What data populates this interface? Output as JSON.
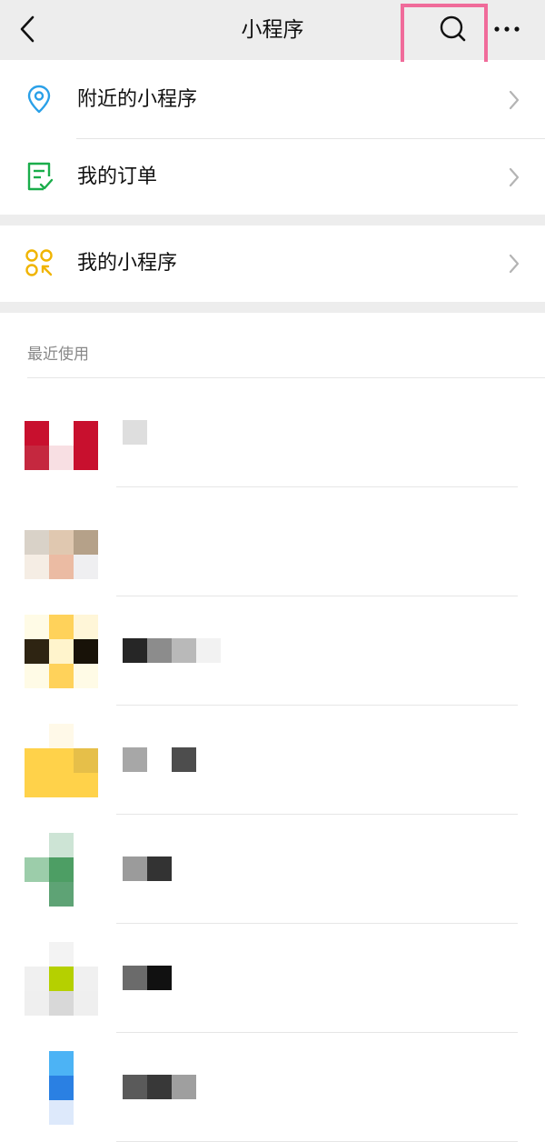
{
  "header": {
    "title": "小程序",
    "back_icon": "chevron-left-icon",
    "search_icon": "search-icon",
    "more_icon": "more-horizontal-icon",
    "highlight_color": "#f06b9a"
  },
  "menu": [
    {
      "label": "附近的小程序",
      "icon": "location-pin-icon",
      "color": "#2aa0e8"
    },
    {
      "label": "我的订单",
      "icon": "order-list-icon",
      "color": "#1aad4b"
    },
    {
      "label": "我的小程序",
      "icon": "mini-programs-icon",
      "color": "#f0b400"
    }
  ],
  "recent": {
    "title": "最近使用",
    "items": [
      {
        "icon_name": "app-icon-red",
        "name": "",
        "tiles": [
          "#ffffff",
          "#ffffff",
          "#ffffff",
          "#c8102e",
          "#ffffff",
          "#c8102e",
          "#c5283f",
          "#f8dfe3",
          "#c8102e"
        ],
        "name_tiles": [
          "#dedede"
        ]
      },
      {
        "icon_name": "app-icon-beige",
        "name": "",
        "tiles": [
          "#ffffff",
          "#ffffff",
          "#ffffff",
          "#d9d2c8",
          "#e0c8b0",
          "#b5a189",
          "#f5ede4",
          "#ebbba3",
          "#efeff1"
        ],
        "name_tiles": []
      },
      {
        "icon_name": "app-icon-yellow-black",
        "name": "",
        "tiles": [
          "#fffbe6",
          "#ffd25a",
          "#fff6d8",
          "#2e2412",
          "#fff4cc",
          "#181208",
          "#fffbe6",
          "#ffd25a",
          "#fffbe6"
        ],
        "name_tiles": [
          "#262626",
          "#8c8c8c",
          "#b9b9b9",
          "#f2f2f2"
        ]
      },
      {
        "icon_name": "app-icon-yellow-folder",
        "name": "",
        "tiles": [
          "#ffffff",
          "#fff9e8",
          "#ffffff",
          "#ffd24a",
          "#ffd24a",
          "#e6bf49",
          "#ffd24a",
          "#ffd24a",
          "#ffd24a"
        ],
        "name_tiles": [
          "#a7a7a7",
          "#ffffff",
          "#4d4d4d"
        ]
      },
      {
        "icon_name": "app-icon-green-cross",
        "name": "",
        "tiles": [
          "#ffffff",
          "#cde4d5",
          "#ffffff",
          "#9ccdaa",
          "#4d9e64",
          "#ffffff",
          "#ffffff",
          "#5ea375",
          "#ffffff"
        ],
        "name_tiles": [
          "#9b9b9b",
          "#333333"
        ]
      },
      {
        "icon_name": "app-icon-lime",
        "name": "",
        "tiles": [
          "#ffffff",
          "#f3f3f3",
          "#ffffff",
          "#f0f0f0",
          "#b5d000",
          "#f0f0f0",
          "#efefef",
          "#d8d8d8",
          "#efefef"
        ],
        "name_tiles": [
          "#6b6b6b",
          "#111111"
        ]
      },
      {
        "icon_name": "app-icon-blue",
        "name": "",
        "tiles": [
          "#ffffff",
          "#4cb3f5",
          "#ffffff",
          "#ffffff",
          "#2a80e3",
          "#ffffff",
          "#ffffff",
          "#dde9fb",
          "#ffffff"
        ],
        "name_tiles": [
          "#5a5a5a",
          "#383838",
          "#9f9f9f"
        ]
      }
    ]
  }
}
